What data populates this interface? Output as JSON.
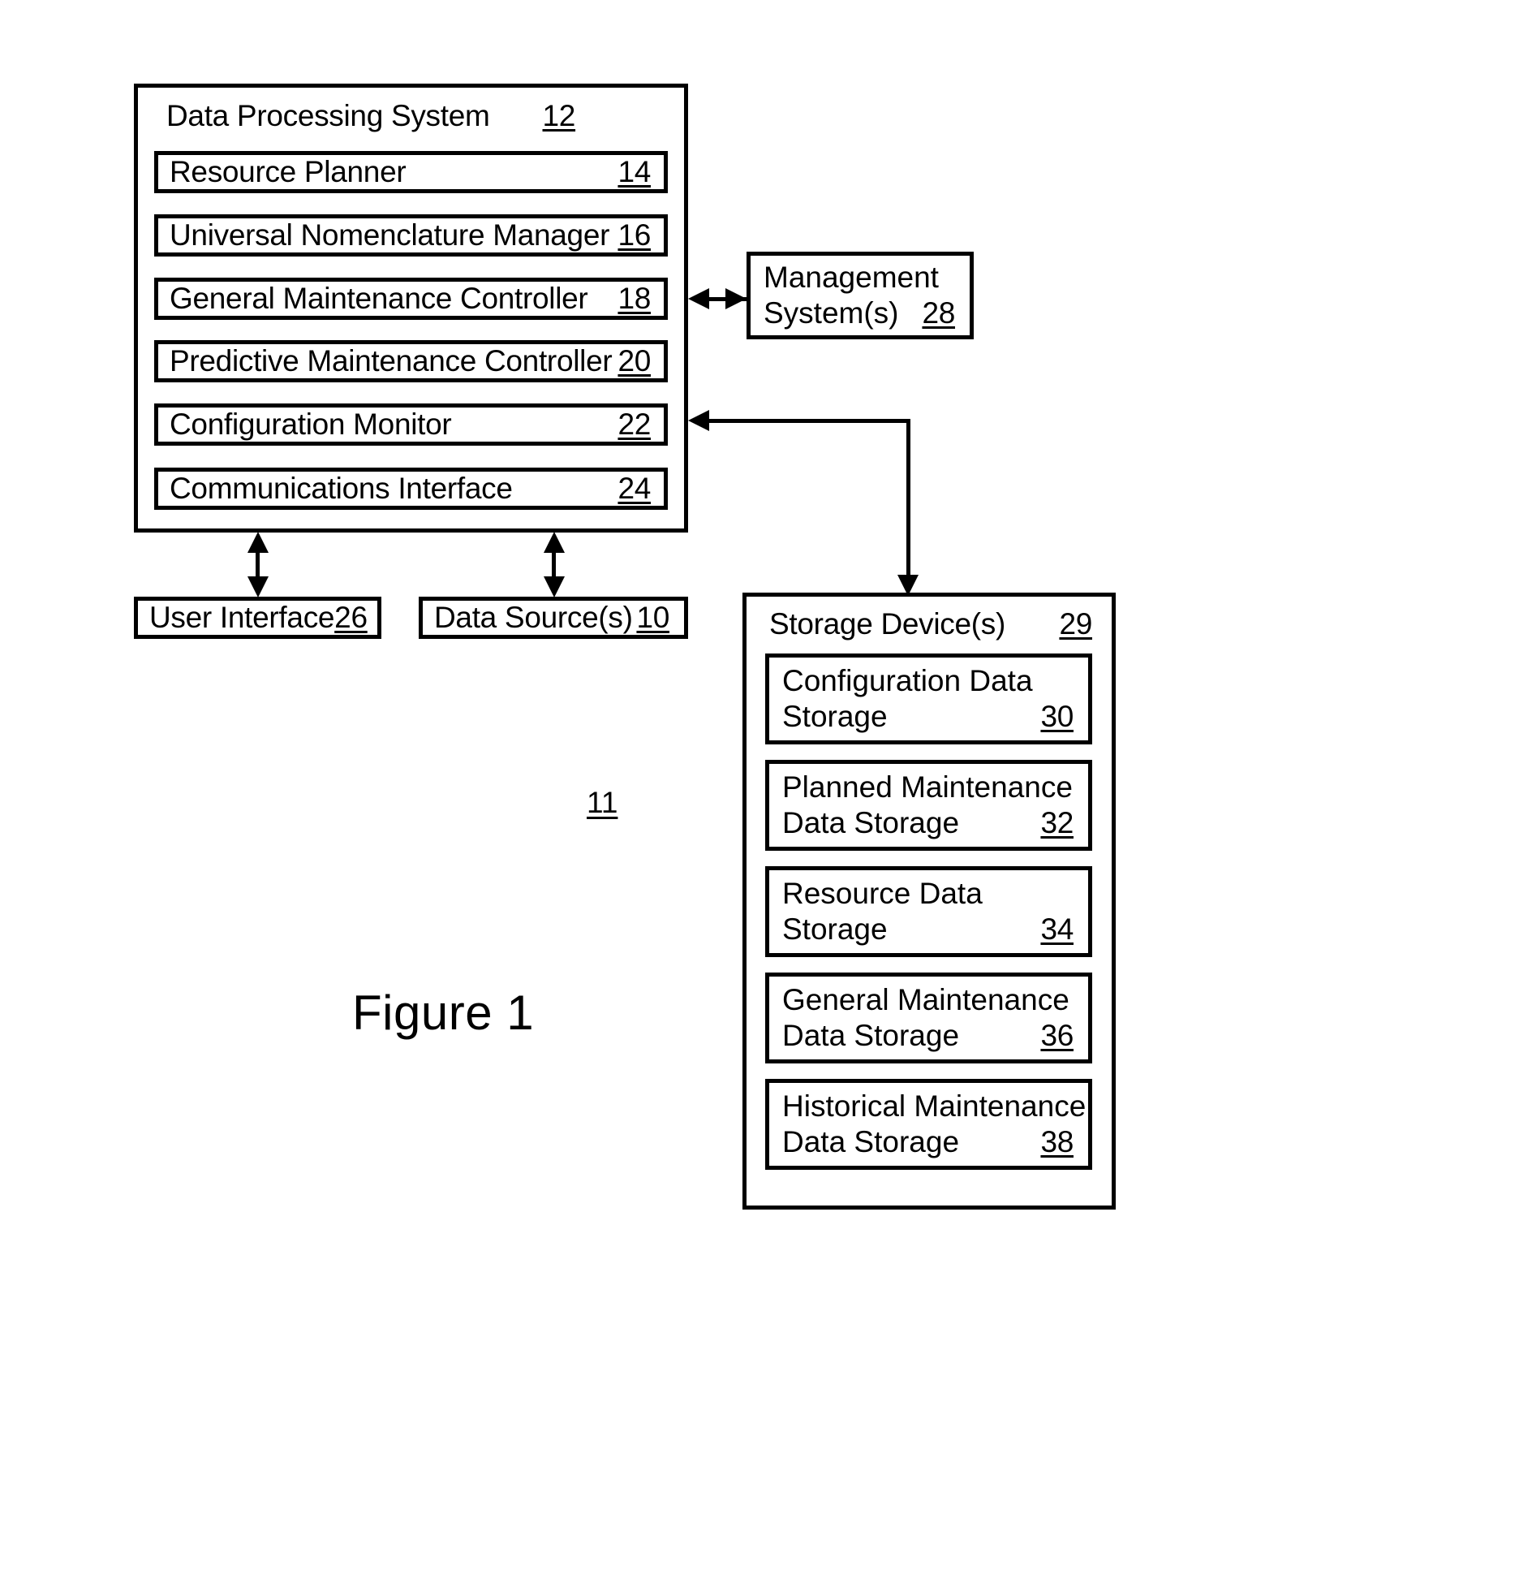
{
  "figure": {
    "caption": "Figure 1",
    "system_ref": "11"
  },
  "data_processing_system": {
    "title": "Data Processing System",
    "ref": "12",
    "modules": [
      {
        "label": "Resource Planner",
        "ref": "14"
      },
      {
        "label": "Universal Nomenclature Manager",
        "ref": "16"
      },
      {
        "label": "General Maintenance Controller",
        "ref": "18"
      },
      {
        "label": "Predictive Maintenance Controller",
        "ref": "20"
      },
      {
        "label": "Configuration Monitor",
        "ref": "22"
      },
      {
        "label": "Communications Interface",
        "ref": "24"
      }
    ]
  },
  "management_system": {
    "line1": "Management",
    "line2": "System(s)",
    "ref": "28"
  },
  "user_interface": {
    "label": "User Interface",
    "ref": "26"
  },
  "data_sources": {
    "label": "Data Source(s)",
    "ref": "10"
  },
  "storage_devices": {
    "title": "Storage Device(s)",
    "ref": "29",
    "stores": [
      {
        "line1": "Configuration Data",
        "line2": "Storage",
        "ref": "30"
      },
      {
        "line1": "Planned Maintenance",
        "line2": "Data Storage",
        "ref": "32"
      },
      {
        "line1": "Resource Data",
        "line2": "Storage",
        "ref": "34"
      },
      {
        "line1": "General Maintenance",
        "line2": "Data Storage",
        "ref": "36"
      },
      {
        "line1": "Historical Maintenance",
        "line2": "Data Storage",
        "ref": "38"
      }
    ]
  },
  "connections": [
    {
      "name": "dps-to-management-system",
      "style": "double-arrow-horizontal"
    },
    {
      "name": "storage-to-configuration-monitor",
      "style": "single-arrow-left"
    },
    {
      "name": "dps-to-user-interface",
      "style": "double-arrow-vertical"
    },
    {
      "name": "dps-to-data-sources",
      "style": "double-arrow-vertical"
    },
    {
      "name": "trunk-to-storage-devices",
      "style": "single-arrow-down"
    }
  ]
}
